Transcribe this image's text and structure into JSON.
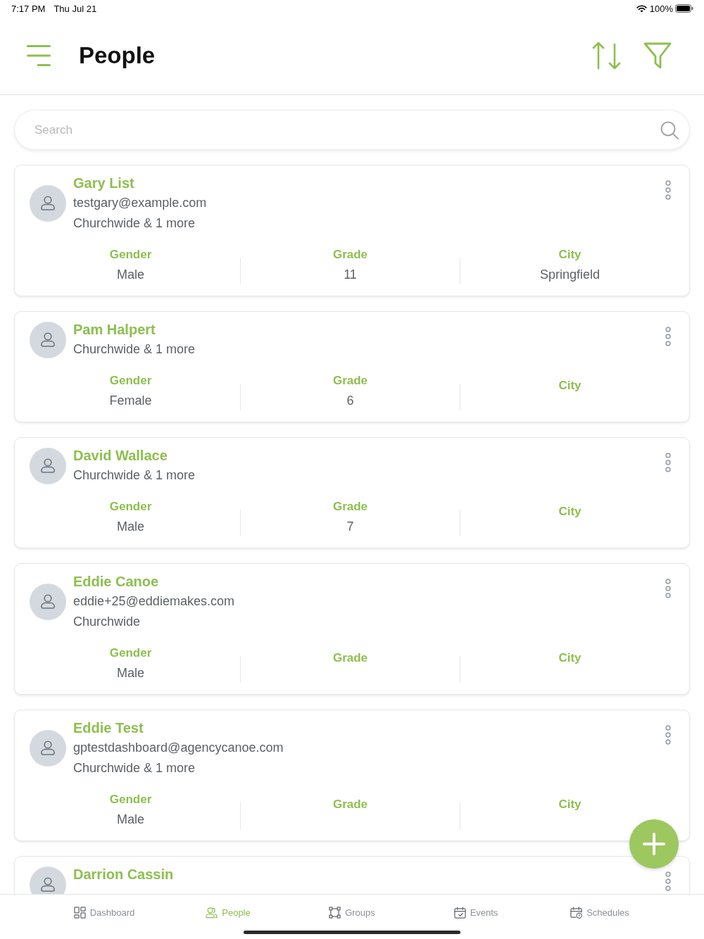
{
  "status_bar": {
    "time": "7:17 PM",
    "date": "Thu Jul 21",
    "battery": "100%"
  },
  "header": {
    "title": "People"
  },
  "search": {
    "placeholder": "Search"
  },
  "people": [
    {
      "name": "Gary List",
      "email": "testgary@example.com",
      "groups": "Churchwide & 1 more",
      "fields": [
        {
          "label": "Gender",
          "value": "Male"
        },
        {
          "label": "Grade",
          "value": "11"
        },
        {
          "label": "City",
          "value": "Springfield"
        }
      ]
    },
    {
      "name": "Pam Halpert",
      "groups": "Churchwide & 1 more",
      "fields": [
        {
          "label": "Gender",
          "value": "Female"
        },
        {
          "label": "Grade",
          "value": "6"
        },
        {
          "label": "City"
        }
      ]
    },
    {
      "name": "David Wallace",
      "groups": "Churchwide & 1 more",
      "fields": [
        {
          "label": "Gender",
          "value": "Male"
        },
        {
          "label": "Grade",
          "value": "7"
        },
        {
          "label": "City"
        }
      ]
    },
    {
      "name": "Eddie Canoe",
      "email": "eddie+25@eddiemakes.com",
      "groups": "Churchwide",
      "fields": [
        {
          "label": "Gender",
          "value": "Male"
        },
        {
          "label": "Grade"
        },
        {
          "label": "City"
        }
      ]
    },
    {
      "name": "Eddie Test",
      "email": "gptestdashboard@agencycanoe.com",
      "groups": "Churchwide & 1 more",
      "fields": [
        {
          "label": "Gender",
          "value": "Male"
        },
        {
          "label": "Grade"
        },
        {
          "label": "City"
        }
      ]
    },
    {
      "name": "Darrion Cassin"
    }
  ],
  "tab_bar": [
    {
      "label": "Dashboard",
      "kind": "dashboard",
      "selected": false
    },
    {
      "label": "People",
      "kind": "people",
      "selected": true
    },
    {
      "label": "Groups",
      "kind": "groups",
      "selected": false
    },
    {
      "label": "Events",
      "kind": "events",
      "selected": false
    },
    {
      "label": "Schedules",
      "kind": "schedules",
      "selected": false
    }
  ]
}
